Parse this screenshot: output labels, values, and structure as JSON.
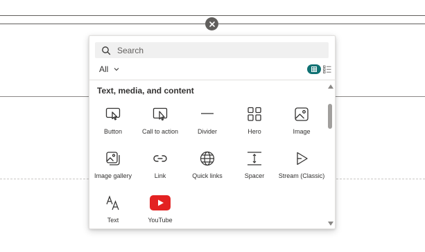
{
  "toolbox": {
    "search": {
      "placeholder": "Search",
      "value": ""
    },
    "filter": {
      "label": "All"
    },
    "section_title": "Text, media, and content",
    "items": [
      {
        "label": "Button",
        "icon": "button-icon"
      },
      {
        "label": "Call to action",
        "icon": "call-to-action-icon"
      },
      {
        "label": "Divider",
        "icon": "divider-icon"
      },
      {
        "label": "Hero",
        "icon": "hero-icon"
      },
      {
        "label": "Image",
        "icon": "image-icon"
      },
      {
        "label": "Image gallery",
        "icon": "image-gallery-icon"
      },
      {
        "label": "Link",
        "icon": "link-icon"
      },
      {
        "label": "Quick links",
        "icon": "quick-links-icon"
      },
      {
        "label": "Spacer",
        "icon": "spacer-icon"
      },
      {
        "label": "Stream (Classic)",
        "icon": "stream-icon"
      },
      {
        "label": "Text",
        "icon": "text-icon"
      },
      {
        "label": "YouTube",
        "icon": "youtube-icon"
      }
    ]
  },
  "colors": {
    "accent": "#0f7173",
    "youtube": "#e32222",
    "text": "#323130"
  }
}
